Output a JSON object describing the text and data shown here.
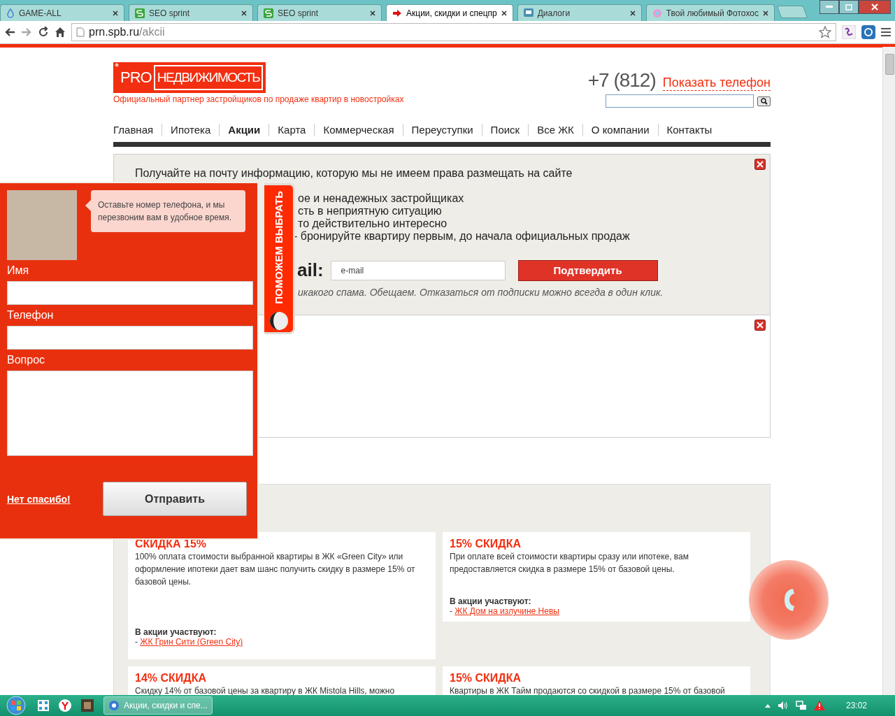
{
  "browser": {
    "tabs": [
      {
        "title": "GAME-ALL",
        "selected": false
      },
      {
        "title": "SEO sprint",
        "selected": false
      },
      {
        "title": "SEO sprint",
        "selected": false
      },
      {
        "title": "Акции, скидки и спецпр",
        "selected": true
      },
      {
        "title": "Диалоги",
        "selected": false
      },
      {
        "title": "Твой любимый Фотохос",
        "selected": false
      }
    ],
    "address": {
      "host": "prn.spb.ru",
      "path": "/akcii"
    }
  },
  "header": {
    "logo_pro": "PRO",
    "logo_name": "НЕДВИЖИМОСТЬ",
    "tagline": "Официальный партнер застройщиков по продаже квартир в новостройках",
    "phone": "+7 (812)",
    "show_phone": "Показать телефон"
  },
  "nav": [
    {
      "label": "Главная",
      "selected": false
    },
    {
      "label": "Ипотека",
      "selected": false
    },
    {
      "label": "Акции",
      "selected": true
    },
    {
      "label": "Карта",
      "selected": false
    },
    {
      "label": "Коммерческая",
      "selected": false
    },
    {
      "label": "Переуступки",
      "selected": false
    },
    {
      "label": "Поиск",
      "selected": false
    },
    {
      "label": "Все ЖК",
      "selected": false
    },
    {
      "label": "О компании",
      "selected": false
    },
    {
      "label": "Контакты",
      "selected": false
    }
  ],
  "subscribe": {
    "heading": "Получайте на почту информацию, которую мы не имеем права размещать на сайте",
    "items": [
      "ое и ненадежных застройщиках",
      "сть в неприятную ситуацию",
      "то действительно интересно",
      "- бронируйте квартиру первым, до начала официальных продаж"
    ],
    "email_label": "ail:",
    "email_placeholder": "e-mail",
    "submit": "Подтвердить",
    "note": "икакого спама. Обещаем. Отказаться от подписки можно всегда в один клик."
  },
  "callback_popup": {
    "bubble": "Оставьте номер телефона, и мы перезвоним вам в удобное время.",
    "fields": [
      {
        "label": "Имя",
        "kind": "input"
      },
      {
        "label": "Телефон",
        "kind": "input"
      },
      {
        "label": "Вопрос",
        "kind": "textarea"
      }
    ],
    "decline": "Нет спасибо!",
    "submit": "Отправить",
    "side_tab": "ПОМОЖЕМ ВЫБРАТЬ"
  },
  "offers": [
    {
      "title": "СКИДКА 15%",
      "text": "100% оплата стоимости выбранной квартиры в ЖК «Green City» или оформление ипотеки дает вам шанс получить скидку в размере 15% от базовой цены.",
      "participants_label": "В акции участвуют:",
      "bullet": "-",
      "links": [
        "ЖК Грин Сити (Green City)"
      ]
    },
    {
      "title": "15% СКИДКА",
      "text": "При оплате всей стоимости квартиры сразу или ипотеке, вам предоставляется скидка в размере 15% от базовой цены.",
      "participants_label": "В акции участвуют:",
      "bullet": "-",
      "links": [
        "ЖК Дом на излучине Невы"
      ]
    },
    {
      "title": "14% СКИДКА",
      "text": "Скидку 14% от базовой цены за квартиру в ЖК Mistola Hills, можно"
    },
    {
      "title": "15% СКИДКА",
      "text": "Квартиры в ЖК Тайм продаются со скидкой в размере 15% от базовой"
    }
  ],
  "taskbar": {
    "window_title": "Акции, скидки и спе...",
    "time": "23:02"
  }
}
